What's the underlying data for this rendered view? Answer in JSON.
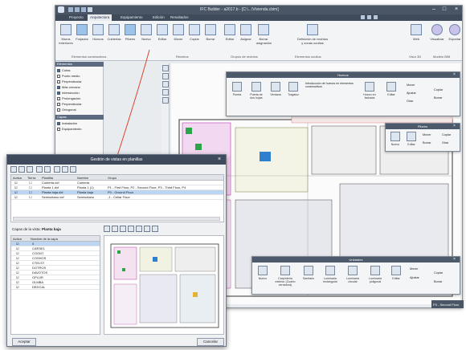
{
  "app": {
    "title": "IFC Builder - a2017.b - [C:\\...\\Vivienda.cbim]",
    "menu_tabs": [
      "Proyecto",
      "Arquitectura",
      "Equipamiento",
      "Edición",
      "Resultados"
    ],
    "active_tab": "Arquitectura",
    "ribbon_buttons": [
      {
        "label": "Muros exteriores",
        "active": false
      },
      {
        "label": "Forjados",
        "active": true
      },
      {
        "label": "Huecos",
        "active": false
      },
      {
        "label": "Cubiertas",
        "active": false
      },
      {
        "label": "Pilares",
        "active": true
      },
      {
        "label": "Nuevo",
        "active": false
      },
      {
        "label": "Editar",
        "active": false
      },
      {
        "label": "Mover",
        "active": false
      },
      {
        "label": "Copiar",
        "active": false
      },
      {
        "label": "Borrar",
        "active": false
      },
      {
        "label": "Editar",
        "active": false
      },
      {
        "label": "Asignar",
        "active": false
      },
      {
        "label": "Borrar asignación",
        "active": false
      },
      {
        "label": "Definición de recintos y zonas ocultas",
        "active": false
      },
      {
        "label": "Web",
        "active": false
      },
      {
        "label": "Visualizar",
        "active": false
      },
      {
        "label": "Exportar",
        "active": false
      }
    ],
    "ribbon_groups": [
      "Elementos constructivos",
      "Recintos",
      "Grupos de recintos",
      "Elementos ocultos",
      "Visor 3D",
      "Modelo BIM"
    ],
    "left_panel": {
      "sections": [
        "Elementos",
        "Capas"
      ],
      "items": [
        {
          "label": "Cotas",
          "checked": true
        },
        {
          "label": "Punto medio",
          "checked": false
        },
        {
          "label": "Perpendicular",
          "checked": false
        },
        {
          "label": "Más cercano",
          "checked": true
        },
        {
          "label": "Intersección",
          "checked": true
        },
        {
          "label": "Prolongación",
          "checked": false
        },
        {
          "label": "Perpendicular",
          "checked": false
        },
        {
          "label": "Ortogonal",
          "checked": false
        }
      ],
      "layer_items": [
        {
          "label": "Instalación",
          "checked": true
        },
        {
          "label": "Equipamiento",
          "checked": false
        }
      ]
    },
    "status_text": "P3 - Second Floor"
  },
  "palettes": {
    "huecos": {
      "title": "Huecos",
      "buttons": [
        "Puerta",
        "Puerta de dos hojas",
        "Ventana",
        "Tragaluz",
        "Hueco en fachada",
        "Editar"
      ],
      "description": "Introducción de huecos en elementos constructivos",
      "side": [
        "Mover",
        "Copiar",
        "Ajustar",
        "Borrar",
        "Girar"
      ]
    },
    "pilares": {
      "title": "Pilares",
      "buttons": [
        "Nuevo",
        "Editar"
      ],
      "side": [
        "Mover",
        "Copiar",
        "Borrar",
        "Girar"
      ]
    },
    "equipos": {
      "title": "Unidades",
      "buttons": [
        "Nuevo",
        "Carpintería exterior (Cuarto cerradura)",
        "Sanitario",
        "Luminaria rectangular",
        "Luminaria circular",
        "Luminaria poligonal",
        "Editar"
      ],
      "side": [
        "Mover",
        "Copiar",
        "Ajustar",
        "Borrar"
      ]
    }
  },
  "dialog": {
    "title": "Gestión de vistas en planillas",
    "table_headers": [
      "Activa",
      "Tierra",
      "Plantilla",
      "Nombre",
      "Grupo"
    ],
    "rows": [
      {
        "active": true,
        "land": false,
        "template": "Cubierta.dxf",
        "name": "Cubierta",
        "group": "",
        "selected": false
      },
      {
        "active": true,
        "land": false,
        "template": "Planta 1.dxf",
        "name": "Planta 1 (1)",
        "group": "P1 - First Floor, P2 - Second Floor, P3 - Third Floor, P4",
        "selected": false
      },
      {
        "active": true,
        "land": false,
        "template": "Planta baja.dxf",
        "name": "Planta baja",
        "group": "P0 - Ground Floor",
        "selected": true
      },
      {
        "active": true,
        "land": false,
        "template": "Semisótano.dxf",
        "name": "Semisótano",
        "group": "-1 - Cellar Floor",
        "selected": false
      }
    ],
    "layers_label": "Capas de la vista:",
    "layers_view": "Planta baja",
    "layers_headers": [
      "Activa",
      "Nombre de la capa"
    ],
    "layers": [
      {
        "active": true,
        "name": "0",
        "selected": true
      },
      {
        "active": true,
        "name": "CARSEL",
        "selected": false
      },
      {
        "active": true,
        "name": "COGNT",
        "selected": false
      },
      {
        "active": true,
        "name": "COSHOS",
        "selected": false
      },
      {
        "active": true,
        "name": "CTELST",
        "selected": false
      },
      {
        "active": true,
        "name": "DOTROS",
        "selected": false
      },
      {
        "active": true,
        "name": "DAVOTOS",
        "selected": false
      },
      {
        "active": true,
        "name": "GPLUR",
        "selected": false
      },
      {
        "active": true,
        "name": "GLMBA",
        "selected": false
      },
      {
        "active": true,
        "name": "DEDCAL",
        "selected": false
      }
    ],
    "accept_label": "Aceptar",
    "cancel_label": "Cancelar"
  },
  "colors": {
    "title_bar": "#4a5566",
    "accent": "#2d6fc0",
    "connector": "#d9452f"
  }
}
